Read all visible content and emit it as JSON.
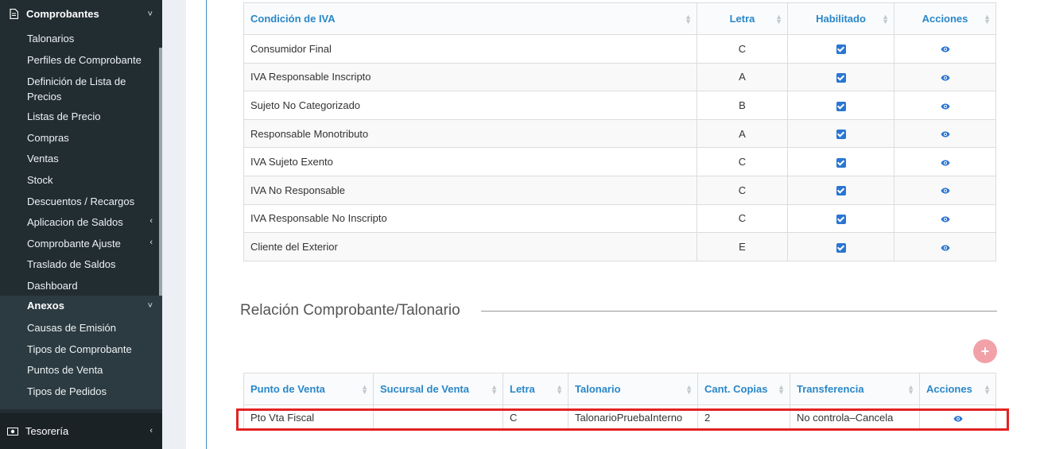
{
  "sidebar": {
    "section_title": "Comprobantes",
    "items": [
      {
        "label": "Talonarios"
      },
      {
        "label": "Perfiles de Comprobante"
      },
      {
        "label": "Definición de Lista de Precios"
      },
      {
        "label": "Listas de Precio"
      },
      {
        "label": "Compras"
      },
      {
        "label": "Ventas"
      },
      {
        "label": "Stock"
      },
      {
        "label": "Descuentos / Recargos"
      },
      {
        "label": "Aplicacion de Saldos"
      },
      {
        "label": "Comprobante Ajuste"
      },
      {
        "label": "Traslado de Saldos"
      },
      {
        "label": "Dashboard"
      }
    ],
    "anexos": {
      "title": "Anexos",
      "items": [
        {
          "label": "Causas de Emisión"
        },
        {
          "label": "Tipos de Comprobante"
        },
        {
          "label": "Puntos de Venta"
        },
        {
          "label": "Tipos de Pedidos"
        }
      ]
    },
    "tesoreria": {
      "label": "Tesorería"
    }
  },
  "iva_table": {
    "headers": [
      "Condición de IVA",
      "Letra",
      "Habilitado",
      "Acciones"
    ],
    "rows": [
      {
        "condicion": "Consumidor Final",
        "letra": "C",
        "habilitado": true
      },
      {
        "condicion": "IVA Responsable Inscripto",
        "letra": "A",
        "habilitado": true
      },
      {
        "condicion": "Sujeto No Categorizado",
        "letra": "B",
        "habilitado": true
      },
      {
        "condicion": "Responsable Monotributo",
        "letra": "A",
        "habilitado": true
      },
      {
        "condicion": "IVA Sujeto Exento",
        "letra": "C",
        "habilitado": true
      },
      {
        "condicion": "IVA No Responsable",
        "letra": "C",
        "habilitado": true
      },
      {
        "condicion": "IVA Responsable No Inscripto",
        "letra": "C",
        "habilitado": true
      },
      {
        "condicion": "Cliente del Exterior",
        "letra": "E",
        "habilitado": true
      }
    ]
  },
  "relacion": {
    "title": "Relación Comprobante/Talonario",
    "add_label": "+",
    "headers": [
      "Punto de Venta",
      "Sucursal de Venta",
      "Letra",
      "Talonario",
      "Cant. Copias",
      "Transferencia",
      "Acciones"
    ],
    "rows": [
      {
        "punto": "Pto Vta Fiscal",
        "sucursal": "",
        "letra": "C",
        "talonario": "TalonarioPruebaInterno",
        "copias": "2",
        "transferencia": "No controla–Cancela"
      }
    ]
  }
}
